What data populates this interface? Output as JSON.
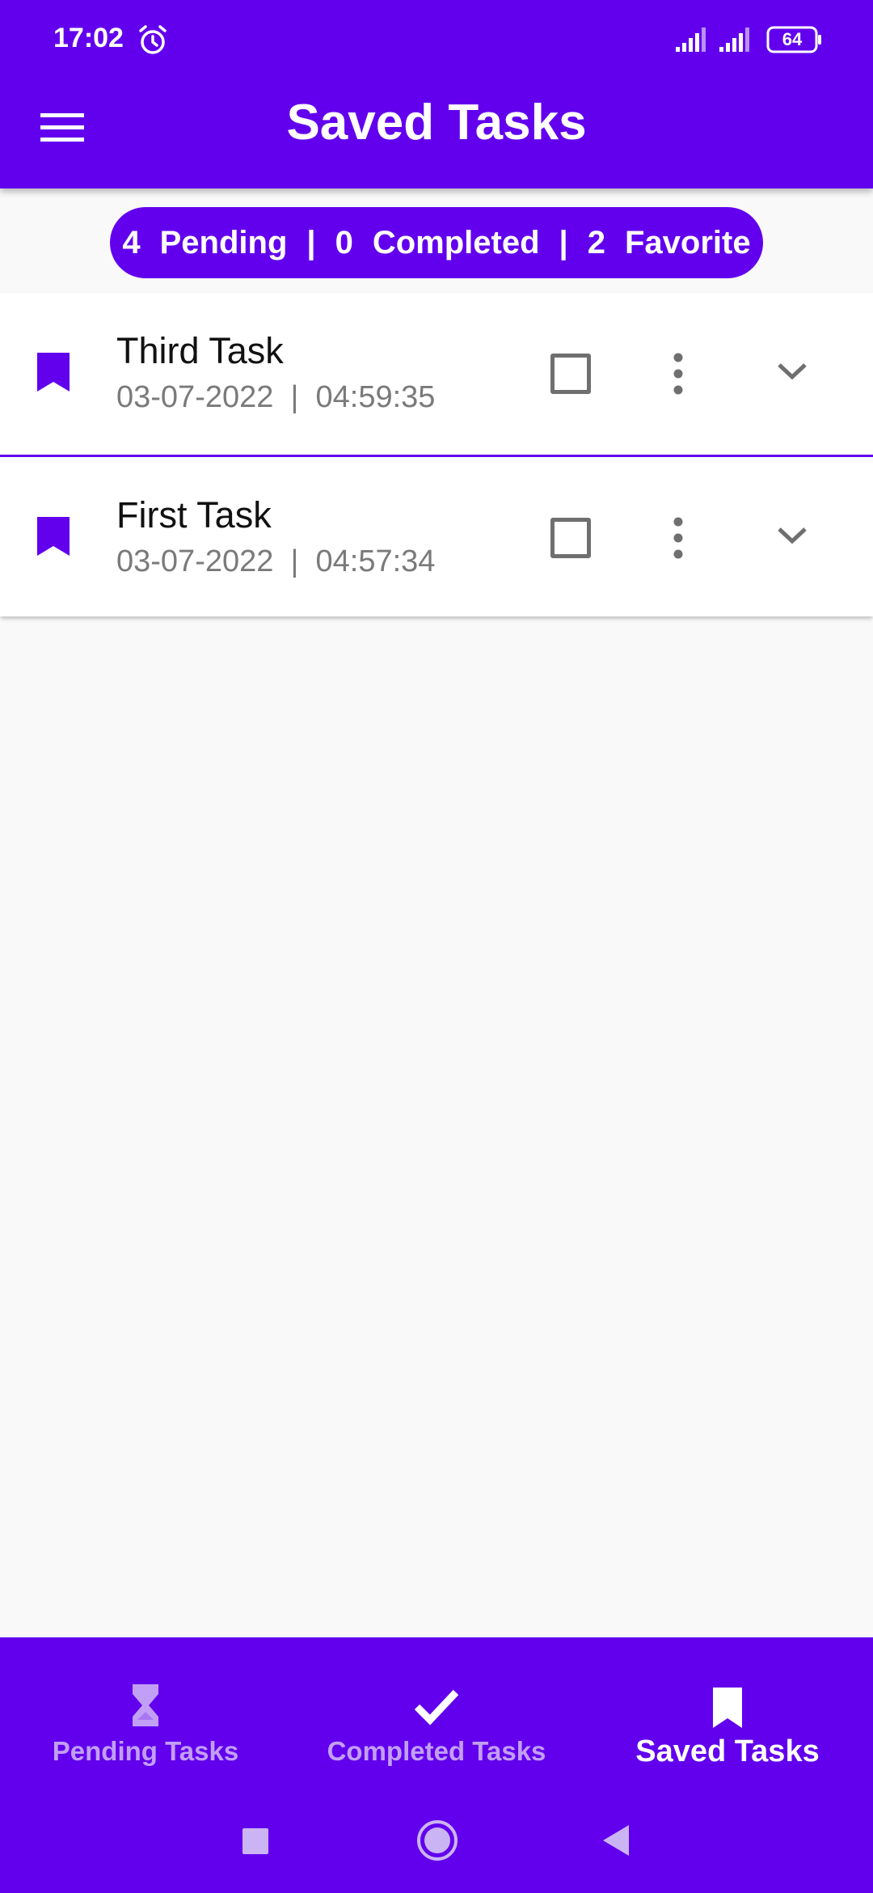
{
  "colors": {
    "primary": "#6200ee",
    "background": "#f9f9f9",
    "inactive_nav": "#c29ff6",
    "meta_text": "#7a7a7a"
  },
  "status_bar": {
    "time": "17:02",
    "battery": "64",
    "icons": [
      "alarm-icon",
      "signal-icon",
      "signal-icon",
      "battery-icon"
    ]
  },
  "app_bar": {
    "title": "Saved Tasks",
    "menu_icon": "hamburger-menu-icon"
  },
  "summary": {
    "pending_count": "4",
    "pending_label": "Pending",
    "completed_count": "0",
    "completed_label": "Completed",
    "favorite_count": "2",
    "favorite_label": "Favorite",
    "separator": "|"
  },
  "tasks": [
    {
      "title": "Third Task",
      "date": "03-07-2022",
      "time": "04:59:35",
      "separator": "|",
      "checked": false,
      "favorite": true
    },
    {
      "title": "First Task",
      "date": "03-07-2022",
      "time": "04:57:34",
      "separator": "|",
      "checked": false,
      "favorite": true
    }
  ],
  "bottom_nav": {
    "items": [
      {
        "label": "Pending Tasks",
        "icon": "hourglass-icon",
        "active": false
      },
      {
        "label": "Completed Tasks",
        "icon": "check-icon",
        "active": false
      },
      {
        "label": "Saved Tasks",
        "icon": "bookmark-icon",
        "active": true
      }
    ]
  },
  "system_nav": {
    "icons": [
      "recents-square-icon",
      "home-circle-icon",
      "back-triangle-icon"
    ]
  }
}
